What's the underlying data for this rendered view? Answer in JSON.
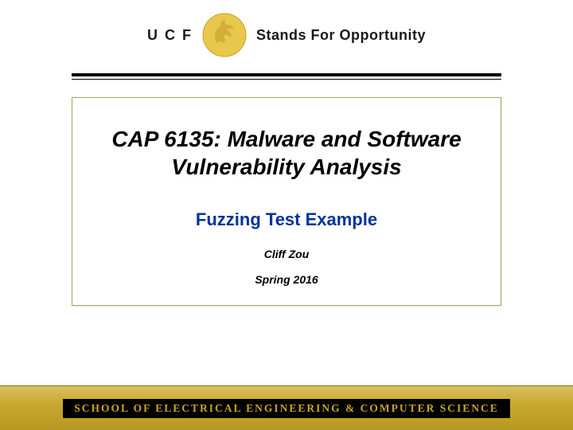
{
  "header": {
    "org_abbr": "U C F",
    "tagline": "Stands For Opportunity"
  },
  "content": {
    "course_title_line1": "CAP 6135: Malware and Software",
    "course_title_line2": "Vulnerability Analysis",
    "subtitle": "Fuzzing Test Example",
    "author": "Cliff Zou",
    "term": "Spring 2016"
  },
  "footer": {
    "school": "SCHOOL OF ELECTRICAL ENGINEERING & COMPUTER SCIENCE"
  }
}
